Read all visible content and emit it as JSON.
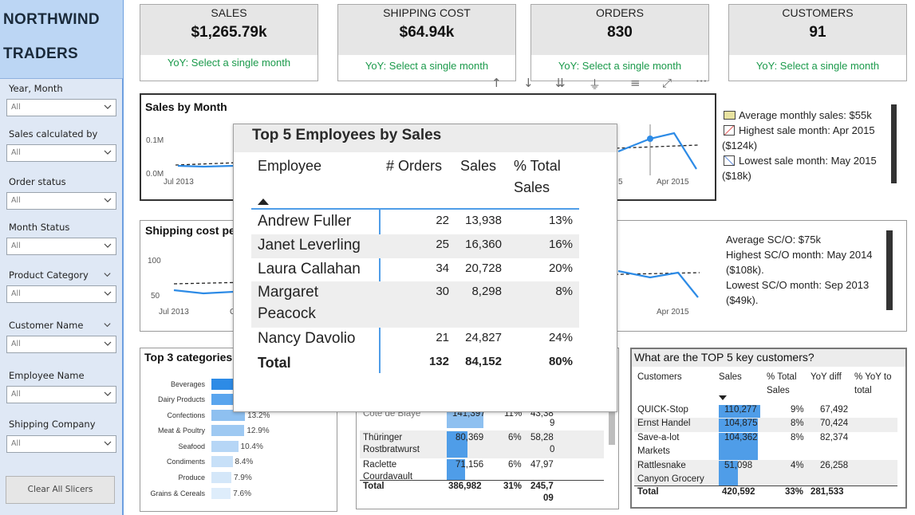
{
  "brand": {
    "line1": "NORTHWIND",
    "line2": "TRADERS"
  },
  "slicers": [
    {
      "label": "Year, Month",
      "value": "All"
    },
    {
      "label": "Sales calculated by",
      "value": "All"
    },
    {
      "label": "Order status",
      "value": "All"
    },
    {
      "label": "Month Status",
      "value": "All"
    },
    {
      "label": "Product Category",
      "value": "All"
    },
    {
      "label": "Customer Name",
      "value": "All"
    },
    {
      "label": "Employee Name",
      "value": "All"
    },
    {
      "label": "Shipping Company",
      "value": "All"
    }
  ],
  "clear_label": "Clear All Slicers",
  "kpis": [
    {
      "title": "SALES",
      "value": "$1,265.79k",
      "yoy": "YoY: Select a single month"
    },
    {
      "title": "SHIPPING COST",
      "value": "$64.94k",
      "yoy": "YoY: Select a single month"
    },
    {
      "title": "ORDERS",
      "value": "830",
      "yoy": "YoY: Select a single month"
    },
    {
      "title": "CUSTOMERS",
      "value": "91",
      "yoy": "YoY: Select a single month"
    }
  ],
  "toolbar": {
    "more": "···"
  },
  "sales_month": {
    "title": "Sales by Month",
    "y_ticks": [
      "0.1M",
      "0.0M"
    ],
    "x_ticks": [
      "Jul 2013",
      "5",
      "Apr 2015"
    ],
    "legend": [
      {
        "text": "Average monthly sales: $55k"
      },
      {
        "text": "Highest sale month: Apr 2015"
      },
      {
        "text": "($124k)"
      },
      {
        "text": "Lowest sale month: May 2015"
      },
      {
        "text": "($18k)"
      }
    ]
  },
  "ship_month": {
    "title": "Shipping cost pe",
    "y_ticks": [
      "100",
      "50"
    ],
    "x_ticks": [
      "Jul 2013",
      "C",
      "Apr 2015"
    ],
    "notes": [
      "Average SC/O: $75k",
      "Highest SC/O month: May 2014",
      "($108k).",
      "Lowest SC/O month: Sep 2013",
      "($49k)."
    ]
  },
  "top3": {
    "title": "Top 3 categories",
    "items": [
      {
        "name": "Beverages",
        "value": "",
        "frac": 1.0
      },
      {
        "name": "Dairy Products",
        "value": "",
        "frac": 0.86
      },
      {
        "name": "Confections",
        "value": "13.2%",
        "frac": 0.54
      },
      {
        "name": "Meat & Poultry",
        "value": "12.9%",
        "frac": 0.53
      },
      {
        "name": "Seafood",
        "value": "10.4%",
        "frac": 0.43
      },
      {
        "name": "Condiments",
        "value": "8.4%",
        "frac": 0.34
      },
      {
        "name": "Produce",
        "value": "7.9%",
        "frac": 0.32
      },
      {
        "name": "Grains & Cereals",
        "value": "7.6%",
        "frac": 0.31
      }
    ]
  },
  "products": {
    "rows": [
      {
        "c1": "Côte de Blaye",
        "c2": "141,397",
        "c3": "11%",
        "c4": "43,38",
        "c4b": "9"
      },
      {
        "c1": "Thüringer",
        "c1b": "Rostbratwurst",
        "c2": "80,369",
        "c3": "6%",
        "c4": "58,28",
        "c4b": "0"
      },
      {
        "c1": "Raclette",
        "c1b": "Courdavault",
        "c2": "71,156",
        "c3": "6%",
        "c4": "47,97"
      }
    ],
    "total": {
      "c1": "Total",
      "c2": "386,982",
      "c3": "31%",
      "c4": "245,7",
      "c4b": "09"
    }
  },
  "customers": {
    "title": "What are the TOP 5 key customers?",
    "headers": {
      "name": "Customers",
      "sales": "Sales",
      "pct1": "% Total",
      "pct2": "Sales",
      "yoy": "YoY diff",
      "yt1": "% YoY to",
      "yt2": "total"
    },
    "rows": [
      {
        "name": "QUICK-Stop",
        "sales": "110,277",
        "pct": "9%",
        "yoy": "67,492",
        "frac": 1.0
      },
      {
        "name": "Ernst Handel",
        "sales": "104,875",
        "pct": "8%",
        "yoy": "70,424",
        "frac": 0.95
      },
      {
        "name": "Save-a-lot",
        "name2": "Markets",
        "sales": "104,362",
        "pct": "8%",
        "yoy": "82,374",
        "frac": 0.94
      },
      {
        "name": "Rattlesnake",
        "name2": "Canyon Grocery",
        "sales": "51,098",
        "pct": "4%",
        "yoy": "26,258",
        "frac": 0.46
      }
    ],
    "total": {
      "name": "Total",
      "sales": "420,592",
      "pct": "33%",
      "yoy": "281,533"
    }
  },
  "employees": {
    "title": "Top 5 Employees by Sales",
    "headers": {
      "name": "Employee",
      "orders": "# Orders",
      "sales": "Sales",
      "pct1": "% Total",
      "pct2": "Sales"
    },
    "rows": [
      {
        "name": "Andrew Fuller",
        "orders": "22",
        "sales": "13,938",
        "pct": "13%"
      },
      {
        "name": "Janet Leverling",
        "orders": "25",
        "sales": "16,360",
        "pct": "16%"
      },
      {
        "name": "Laura Callahan",
        "orders": "34",
        "sales": "20,728",
        "pct": "20%"
      },
      {
        "name": "Margaret",
        "name2": "Peacock",
        "orders": "30",
        "sales": "8,298",
        "pct": "8%"
      },
      {
        "name": "Nancy Davolio",
        "orders": "21",
        "sales": "24,827",
        "pct": "24%"
      }
    ],
    "total": {
      "name": "Total",
      "orders": "132",
      "sales": "84,152",
      "pct": "80%"
    }
  },
  "colors": {
    "accent": "#4f9de8",
    "yoy_green": "#1b9a4b",
    "sidebar": "#dfe8f5",
    "brand_bg": "#bcd6f4"
  }
}
